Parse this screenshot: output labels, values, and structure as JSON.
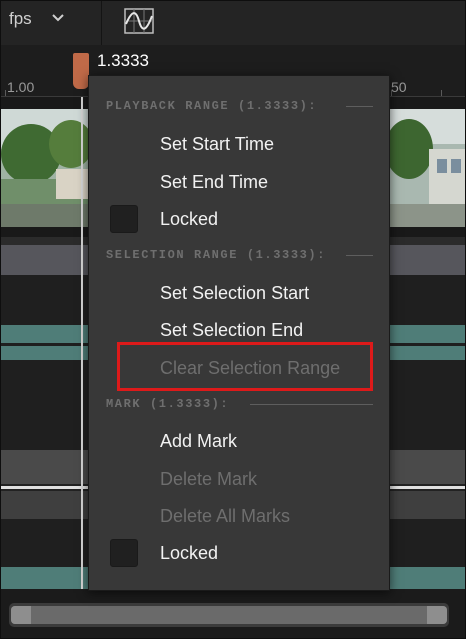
{
  "toolbar": {
    "fps_label": "fps",
    "chevron_icon": "chevron-down-icon",
    "curve_icon": "curve-editor-icon"
  },
  "ruler": {
    "tick_start": "1.00",
    "tick_partial": "50",
    "current_time": "1.3333"
  },
  "menu": {
    "playback_header": "PLAYBACK RANGE (1.3333):",
    "set_start_time": "Set Start Time",
    "set_end_time": "Set End Time",
    "locked": "Locked",
    "selection_header": "SELECTION RANGE (1.3333):",
    "set_selection_start": "Set Selection Start",
    "set_selection_end": "Set Selection End",
    "clear_selection_range": "Clear Selection Range",
    "mark_header": "MARK (1.3333):",
    "add_mark": "Add Mark",
    "delete_mark": "Delete Mark",
    "delete_all_marks": "Delete All Marks",
    "mark_locked": "Locked"
  },
  "colors": {
    "highlight": "#dd1a1a",
    "scrub_handle": "#c06a48",
    "lane_teal": "#4f7d78"
  }
}
